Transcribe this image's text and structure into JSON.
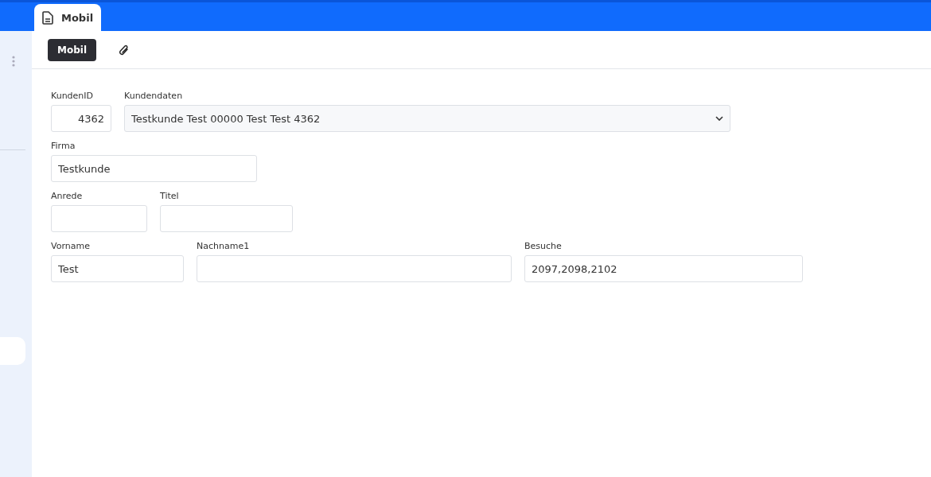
{
  "tabs": [
    {
      "label": "Mobil",
      "selected": true
    }
  ],
  "toolbar": {
    "buttons": [
      {
        "label": "Mobil",
        "selected": true
      }
    ]
  },
  "form": {
    "rows": [
      {
        "fields": [
          {
            "kind": "number",
            "label": "KundenID",
            "value": "4362"
          },
          {
            "kind": "select",
            "label": "Kundendaten",
            "value": "Testkunde Test 00000 Test Test 4362"
          }
        ]
      },
      {
        "fields": [
          {
            "kind": "text",
            "label": "Firma",
            "value": "Testkunde"
          }
        ]
      },
      {
        "fields": [
          {
            "kind": "text",
            "label": "Anrede"
          },
          {
            "kind": "text",
            "label": "Titel"
          }
        ]
      },
      {
        "fields": [
          {
            "kind": "text",
            "label": "Vorname",
            "value": "Test"
          },
          {
            "kind": "text",
            "label": "Nachname1"
          },
          {
            "kind": "text",
            "label": "Besuche",
            "value": "2097,2098,2102"
          }
        ]
      }
    ]
  }
}
